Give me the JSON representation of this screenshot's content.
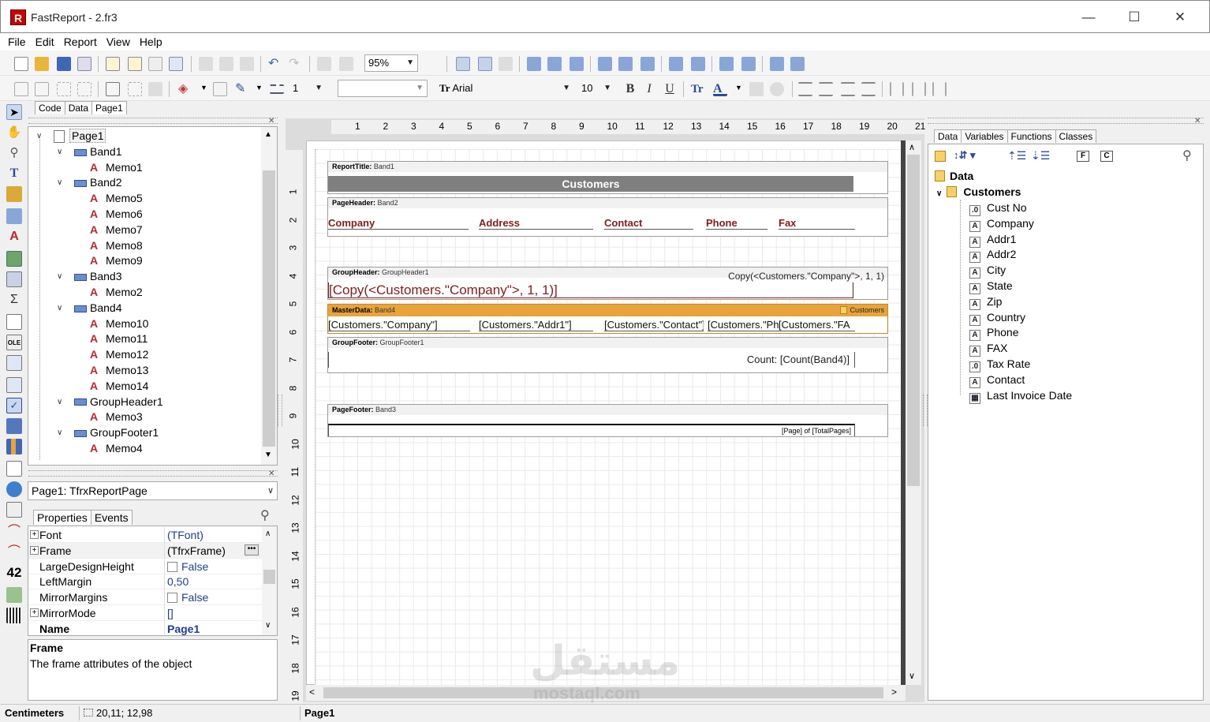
{
  "window": {
    "title": "FastReport - 2.fr3",
    "minimize": "—",
    "maximize": "☐",
    "close": "✕"
  },
  "menu": [
    "File",
    "Edit",
    "Report",
    "View",
    "Help"
  ],
  "toolbar": {
    "zoom": "95%",
    "font_name": "Arial",
    "font_size": "10",
    "line_width": "1",
    "style_combo": ""
  },
  "left_tabs": [
    "Code",
    "Data",
    "Page1"
  ],
  "tree": [
    {
      "label": "Page1",
      "level": 0,
      "kind": "page",
      "toggle": "∨"
    },
    {
      "label": "Band1",
      "level": 1,
      "kind": "band",
      "toggle": "∨"
    },
    {
      "label": "Memo1",
      "level": 2,
      "kind": "memo"
    },
    {
      "label": "Band2",
      "level": 1,
      "kind": "band",
      "toggle": "∨"
    },
    {
      "label": "Memo5",
      "level": 2,
      "kind": "memo"
    },
    {
      "label": "Memo6",
      "level": 2,
      "kind": "memo"
    },
    {
      "label": "Memo7",
      "level": 2,
      "kind": "memo"
    },
    {
      "label": "Memo8",
      "level": 2,
      "kind": "memo"
    },
    {
      "label": "Memo9",
      "level": 2,
      "kind": "memo"
    },
    {
      "label": "Band3",
      "level": 1,
      "kind": "band",
      "toggle": "∨"
    },
    {
      "label": "Memo2",
      "level": 2,
      "kind": "memo"
    },
    {
      "label": "Band4",
      "level": 1,
      "kind": "band",
      "toggle": "∨"
    },
    {
      "label": "Memo10",
      "level": 2,
      "kind": "memo"
    },
    {
      "label": "Memo11",
      "level": 2,
      "kind": "memo"
    },
    {
      "label": "Memo12",
      "level": 2,
      "kind": "memo"
    },
    {
      "label": "Memo13",
      "level": 2,
      "kind": "memo"
    },
    {
      "label": "Memo14",
      "level": 2,
      "kind": "memo"
    },
    {
      "label": "GroupHeader1",
      "level": 1,
      "kind": "band",
      "toggle": "∨"
    },
    {
      "label": "Memo3",
      "level": 2,
      "kind": "memo"
    },
    {
      "label": "GroupFooter1",
      "level": 1,
      "kind": "band",
      "toggle": "∨"
    },
    {
      "label": "Memo4",
      "level": 2,
      "kind": "memo"
    }
  ],
  "object_combo": "Page1: TfrxReportPage",
  "prop_tabs": [
    "Properties",
    "Events"
  ],
  "properties": [
    {
      "name": "Font",
      "value": "(TFont)",
      "expand": "+",
      "checkbox": false,
      "bold": false
    },
    {
      "name": "Frame",
      "value": "(TfrxFrame)",
      "expand": "+",
      "checkbox": false,
      "bold": false,
      "value_color": "#000"
    },
    {
      "name": "LargeDesignHeight",
      "value": "False",
      "expand": "",
      "checkbox": true,
      "bold": false
    },
    {
      "name": "LeftMargin",
      "value": "0,50",
      "expand": "",
      "checkbox": false,
      "bold": false
    },
    {
      "name": "MirrorMargins",
      "value": "False",
      "expand": "",
      "checkbox": true,
      "bold": false
    },
    {
      "name": "MirrorMode",
      "value": "[]",
      "expand": "+",
      "checkbox": false,
      "bold": false
    },
    {
      "name": "Name",
      "value": "Page1",
      "expand": "",
      "checkbox": false,
      "bold": true
    }
  ],
  "help": {
    "title": "Frame",
    "text": "The frame attributes of the object"
  },
  "ruler_h": [
    "1",
    "2",
    "3",
    "4",
    "5",
    "6",
    "7",
    "8",
    "9",
    "10",
    "11",
    "12",
    "13",
    "14",
    "15",
    "16",
    "17",
    "18",
    "19",
    "20",
    "21"
  ],
  "ruler_v": [
    "1",
    "2",
    "3",
    "4",
    "5",
    "6",
    "7",
    "8",
    "9",
    "10",
    "11",
    "12",
    "13",
    "14",
    "15",
    "16",
    "17",
    "18",
    "19"
  ],
  "bands": {
    "report_title": {
      "type": "ReportTitle:",
      "name": "Band1",
      "memo": "Customers"
    },
    "page_header": {
      "type": "PageHeader:",
      "name": "Band2",
      "fields": [
        "Company",
        "Address",
        "Contact",
        "Phone",
        "Fax"
      ]
    },
    "group_header": {
      "type": "GroupHeader:",
      "name": "GroupHeader1",
      "condition": "Copy(<Customers.\"Company\">, 1, 1)",
      "memo": "[Copy(<Customers.\"Company\">, 1, 1)]"
    },
    "master_data": {
      "type": "MasterData:",
      "name": "Band4",
      "dataset": "Customers",
      "fields": [
        "[Customers.\"Company\"]",
        "[Customers.\"Addr1\"]",
        "[Customers.\"Contact\"]",
        "[Customers.\"Ph",
        "[Customers.\"FA"
      ]
    },
    "group_footer": {
      "type": "GroupFooter:",
      "name": "GroupFooter1",
      "memo": "Count: [Count(Band4)]"
    },
    "page_footer": {
      "type": "PageFooter:",
      "name": "Band3",
      "memo": "[Page] of [TotalPages]"
    }
  },
  "right_tabs": [
    "Data",
    "Variables",
    "Functions",
    "Classes"
  ],
  "data_tree": {
    "root": "Data",
    "dataset": "Customers",
    "fields": [
      {
        "label": "Cust No",
        "icon": ".0"
      },
      {
        "label": "Company",
        "icon": "A"
      },
      {
        "label": "Addr1",
        "icon": "A"
      },
      {
        "label": "Addr2",
        "icon": "A"
      },
      {
        "label": "City",
        "icon": "A"
      },
      {
        "label": "State",
        "icon": "A"
      },
      {
        "label": "Zip",
        "icon": "A"
      },
      {
        "label": "Country",
        "icon": "A"
      },
      {
        "label": "Phone",
        "icon": "A"
      },
      {
        "label": "FAX",
        "icon": "A"
      },
      {
        "label": "Tax Rate",
        "icon": ".0"
      },
      {
        "label": "Contact",
        "icon": "A"
      },
      {
        "label": "Last Invoice Date",
        "icon": "▦"
      }
    ]
  },
  "status": {
    "units": "Centimeters",
    "coords": "20,11; 12,98",
    "page": "Page1"
  },
  "watermark": {
    "arabic": "مستقل",
    "latin": "mostaql.com"
  },
  "colors": {
    "accent_band": "#e8a33b",
    "title_fill": "#7f7f7f",
    "memo_text": "#8b1a1a"
  }
}
